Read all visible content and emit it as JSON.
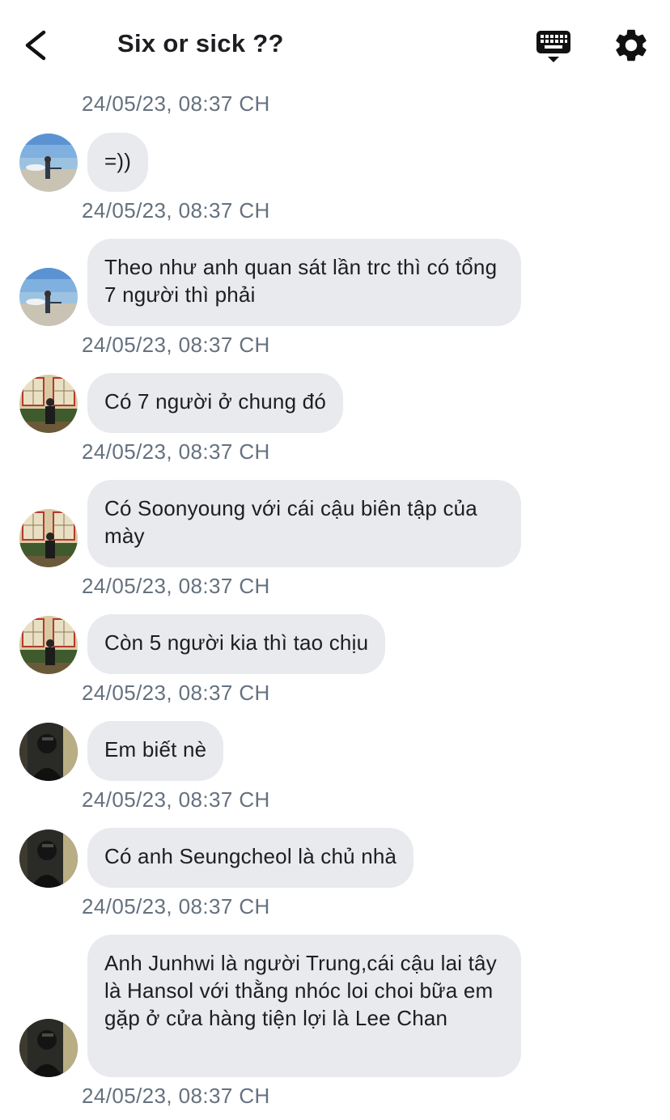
{
  "header": {
    "title": "Six or sick ??",
    "back_icon": "chevron-left-icon",
    "keyboard_icon": "keyboard-icon",
    "settings_icon": "gear-icon"
  },
  "colors": {
    "bubble": "#e8eaee",
    "timestamp": "#65717f",
    "text": "#1c1e21"
  },
  "messages": [
    {
      "timestamp": "24/05/23, 08:37 CH",
      "text": "=))",
      "avatar": "beach-avatar"
    },
    {
      "timestamp": "24/05/23, 08:37 CH",
      "text": "Theo như anh quan sát lần trc thì có tổng 7 người thì phải",
      "avatar": "beach-avatar"
    },
    {
      "timestamp": "24/05/23, 08:37 CH",
      "text": "Có 7 người ở chung đó",
      "avatar": "room-avatar"
    },
    {
      "timestamp": "24/05/23, 08:37 CH",
      "text": "Có Soonyoung với cái cậu biên tập của mày",
      "avatar": "room-avatar"
    },
    {
      "timestamp": "24/05/23, 08:37 CH",
      "text": "Còn 5 người kia thì tao chịu",
      "avatar": "room-avatar"
    },
    {
      "timestamp": "24/05/23, 08:37 CH",
      "text": "Em biết nè",
      "avatar": "dark-avatar"
    },
    {
      "timestamp": "24/05/23, 08:37 CH",
      "text": "Có anh Seungcheol là chủ nhà",
      "avatar": "dark-avatar"
    },
    {
      "timestamp": "24/05/23, 08:37 CH",
      "text": "Anh Junhwi là người Trung,cái cậu lai tây là Hansol với thằng nhóc loi choi bữa em gặp ở cửa hàng tiện lợi là Lee Chan",
      "avatar": "dark-avatar"
    }
  ],
  "footer_timestamp": "24/05/23, 08:37 CH"
}
